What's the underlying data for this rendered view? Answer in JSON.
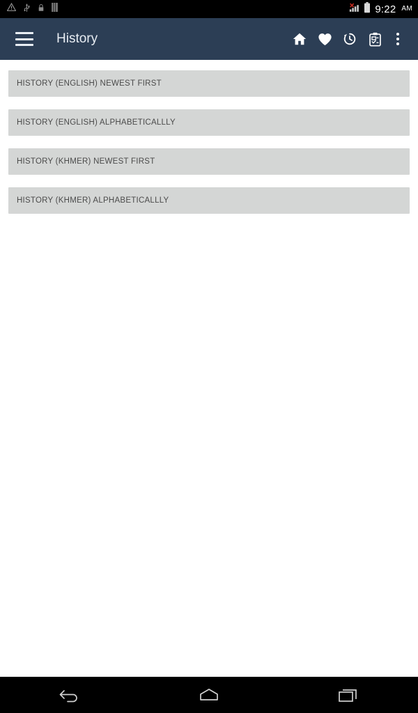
{
  "status_bar": {
    "icons": [
      {
        "name": "warning-icon",
        "glyph": "warning-triangle"
      },
      {
        "name": "usb-icon",
        "glyph": "usb"
      },
      {
        "name": "lock-icon",
        "glyph": "padlock"
      },
      {
        "name": "vibrate-icon",
        "glyph": "sim-bars"
      }
    ],
    "signal": {
      "name": "signal-no-service-icon",
      "bars": 4
    },
    "battery": {
      "name": "battery-icon",
      "level": "full"
    },
    "time": "9:22",
    "meridiem": "AM",
    "background": "#000000"
  },
  "action_bar": {
    "menu_icon": "hamburger-menu-icon",
    "title": "History",
    "background": "#2c3e55",
    "text_color": "#e7ecf2",
    "actions": [
      {
        "name": "home-icon",
        "label": "Home"
      },
      {
        "name": "favorites-heart-icon",
        "label": "Favorites"
      },
      {
        "name": "history-clock-icon",
        "label": "History"
      },
      {
        "name": "quiz-clipboard-icon",
        "label": "Quiz"
      },
      {
        "name": "overflow-menu-icon",
        "label": "More options"
      }
    ]
  },
  "content": {
    "background": "#ffffff",
    "button_background": "#d4d6d5",
    "button_text_color": "#4b4b4b",
    "buttons": [
      {
        "label": "HISTORY (ENGLISH) NEWEST FIRST"
      },
      {
        "label": "HISTORY (ENGLISH) ALPHABETICALLLY"
      },
      {
        "label": "HISTORY (KHMER) NEWEST FIRST"
      },
      {
        "label": "HISTORY (KHMER) ALPHABETICALLLY"
      }
    ]
  },
  "nav_bar": {
    "background": "#000000",
    "buttons": [
      {
        "name": "back-icon",
        "label": "Back"
      },
      {
        "name": "home-icon",
        "label": "Home"
      },
      {
        "name": "recents-icon",
        "label": "Recent apps"
      }
    ]
  }
}
